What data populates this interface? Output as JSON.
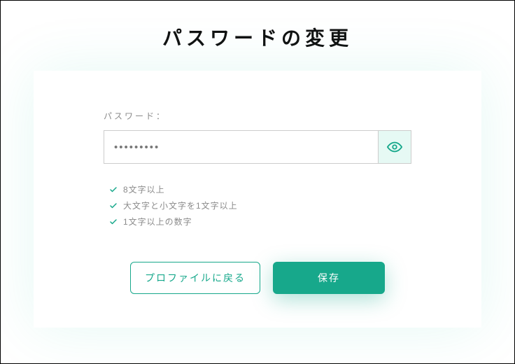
{
  "colors": {
    "accent": "#17a88b",
    "accent_light": "#e6f9f4",
    "text_muted": "#8a8a8a"
  },
  "page": {
    "title": "パスワードの変更"
  },
  "form": {
    "password_label": "パスワード：",
    "password_value": "•••••••••",
    "rules": [
      "8文字以上",
      "大文字と小文字を1文字以上",
      "1文字以上の数字"
    ]
  },
  "buttons": {
    "back_to_profile": "プロファイルに戻る",
    "save": "保存"
  },
  "icons": {
    "eye": "eye-icon",
    "check": "check-icon"
  }
}
